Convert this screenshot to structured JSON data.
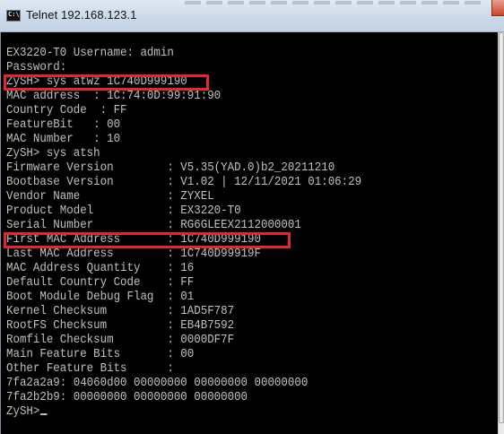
{
  "window": {
    "title": "Telnet 192.168.123.1",
    "icon": "console-icon"
  },
  "console": {
    "lines": [
      "",
      "EX3220-T0 Username: admin",
      "Password:",
      "ZySH> sys atwz 1C740D999190",
      "MAC address  : 1C:74:0D:99:91:90",
      "Country Code  : FF",
      "FeatureBit   : 00",
      "MAC Number   : 10",
      "ZySH> sys atsh",
      "Firmware Version        : V5.35(YAD.0)b2_20211210",
      "Bootbase Version        : V1.02 | 12/11/2021 01:06:29",
      "Vendor Name             : ZYXEL",
      "Product Model           : EX3220-T0",
      "Serial Number           : RG6GLEEX2112000001",
      "First MAC Address       : 1C740D999190",
      "Last MAC Address        : 1C740D99919F",
      "MAC Address Quantity    : 16",
      "Default Country Code    : FF",
      "Boot Module Debug Flag  : 01",
      "Kernel Checksum         : 1AD5F787",
      "RootFS Checksum         : EB4B7592",
      "Romfile Checksum        : 0000DF7F",
      "Main Feature Bits       : 00",
      "Other Feature Bits      :",
      "7fa2a2a9: 04060d00 00000000 00000000 00000000",
      "7fa2b2b9: 00000000 00000000 00000000",
      "ZySH>"
    ]
  },
  "colors": {
    "console_background": "#000000",
    "console_text": "#c0c0c0",
    "highlight_border": "#e0292f"
  }
}
